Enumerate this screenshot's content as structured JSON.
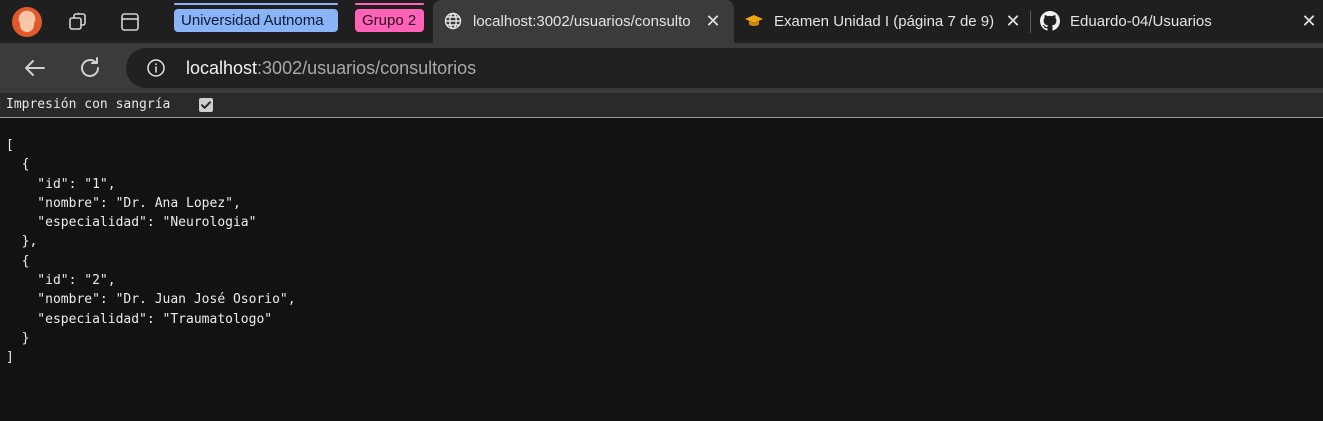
{
  "tab_groups": [
    {
      "label": "Universidad Autnoma",
      "color": "#8ab4f8"
    },
    {
      "label": "Grupo 2",
      "color": "#ff63b8"
    }
  ],
  "tabs": [
    {
      "title": "localhost:3002/usuarios/consultorios",
      "favicon": "globe-icon",
      "active": true
    },
    {
      "title": "Examen Unidad I (página 7 de 9) |",
      "favicon": "graduation-cap-icon",
      "active": false
    },
    {
      "title": "Eduardo-04/Usuarios",
      "favicon": "github-icon",
      "active": false
    }
  ],
  "address_bar": {
    "host": "localhost",
    "rest": ":3002/usuarios/consultorios"
  },
  "pretty_print": {
    "label": "Impresión con sangría",
    "checked": true
  },
  "json_lines": [
    "[",
    "  {",
    "    \"id\": \"1\",",
    "    \"nombre\": \"Dr. Ana Lopez\",",
    "    \"especialidad\": \"Neurologia\"",
    "  },",
    "  {",
    "    \"id\": \"2\",",
    "    \"nombre\": \"Dr. Juan José Osorio\",",
    "    \"especialidad\": \"Traumatologo\"",
    "  }",
    "]"
  ]
}
